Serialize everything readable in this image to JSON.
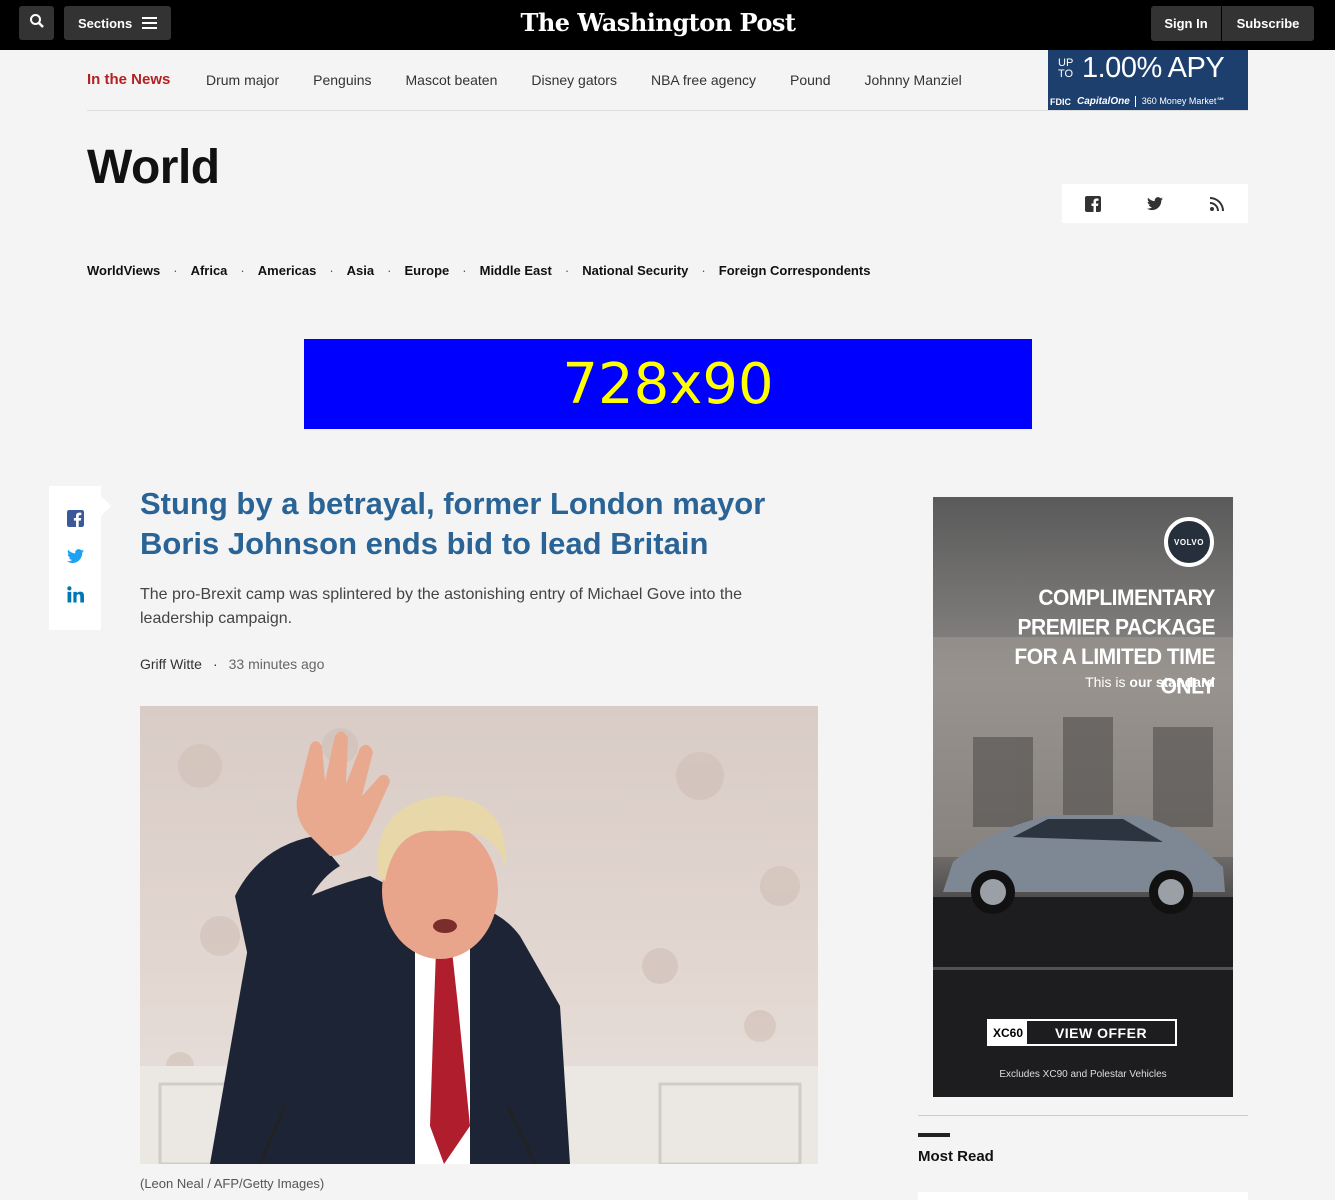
{
  "header": {
    "logo": "The Washington Post",
    "sections_label": "Sections",
    "signin_label": "Sign In",
    "subscribe_label": "Subscribe"
  },
  "news_bar": {
    "label": "In the News",
    "items": [
      "Drum major",
      "Penguins",
      "Mascot beaten",
      "Disney gators",
      "NBA free agency",
      "Pound",
      "Johnny Manziel"
    ]
  },
  "promo": {
    "up_to": "UP TO",
    "rate": "1.00% APY",
    "fdic": "FDIC",
    "brand": "CapitalOne",
    "product": "360 Money Market℠"
  },
  "page": {
    "title": "World"
  },
  "subnav": {
    "items": [
      "WorldViews",
      "Africa",
      "Americas",
      "Asia",
      "Europe",
      "Middle East",
      "National Security",
      "Foreign Correspondents"
    ]
  },
  "banner_ad": {
    "text": "728x90"
  },
  "article": {
    "headline": "Stung by a betrayal, former London mayor Boris Johnson ends bid to lead Britain",
    "dek": "The pro-Brexit camp was splintered by the astonishing entry of Michael Gove into the leadership campaign.",
    "author": "Griff Witte",
    "time": "33 minutes ago",
    "caption": "(Leon Neal / AFP/Getty Images)"
  },
  "right_ad": {
    "logo_text": "VOLVO",
    "headline_lines": [
      "COMPLIMENTARY",
      "PREMIER PACKAGE",
      "FOR A LIMITED TIME ONLY"
    ],
    "tag_prefix": "This is ",
    "tag_bold": "our standard",
    "cta_model": "XC60",
    "cta_label": "VIEW OFFER",
    "disclaimer": "Excludes XC90 and Polestar Vehicles"
  },
  "sidebar": {
    "most_read_title": "Most Read"
  },
  "colors": {
    "headline": "#2a6496",
    "news_label": "#b22222",
    "banner_bg": "#0000ff",
    "banner_text": "#ffff00",
    "facebook": "#3b5998",
    "twitter": "#1da1f2",
    "linkedin": "#0077b5"
  }
}
